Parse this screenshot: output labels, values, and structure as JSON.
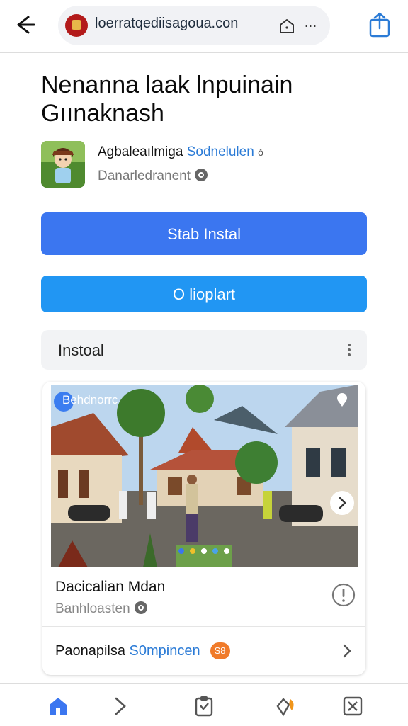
{
  "browser": {
    "url": "loerratqediisagoua.con",
    "back_icon": "arrow-left-icon",
    "share_icon": "share-icon",
    "menu_icon": "more-dots-icon",
    "menu_label": "..."
  },
  "page": {
    "title": "Nenanna Ɩaak lnpuinain Gıınaknash",
    "app_name": "Agbaleaılmiga",
    "app_name_accent": "Sodnelulen",
    "app_name_suffix": "ǒ",
    "developer": "Danarledranent"
  },
  "buttons": {
    "primary": "Stab Instal",
    "secondary": "O lioplart"
  },
  "install_row": {
    "label": "Instoal"
  },
  "card": {
    "photo_tag": "Behdnorrc",
    "title": "Dacicalian Mdan",
    "subtitle": "Banhloasten",
    "footer_text": "Paonapilsa",
    "footer_accent": "S0mpincen",
    "footer_badge": "S8"
  },
  "colors": {
    "primary_button": "#3b76f0",
    "secondary_button": "#2196f3",
    "accent_text": "#2b7bd6",
    "badge_orange": "#f07b2a"
  },
  "bottom_nav": [
    "home-icon",
    "forward-icon",
    "clipboard-icon",
    "notification-icon",
    "close-box-icon"
  ]
}
